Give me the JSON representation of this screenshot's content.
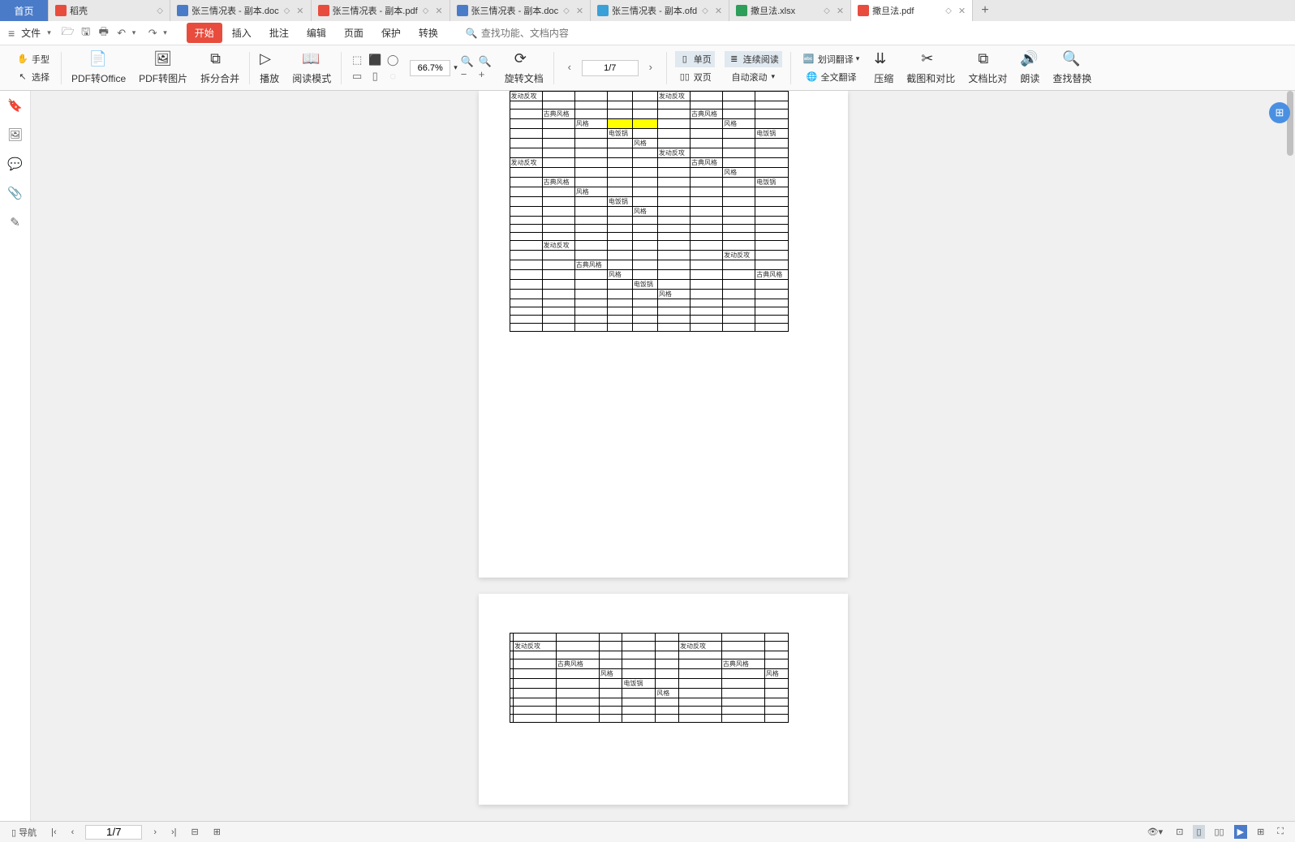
{
  "tabs": {
    "home": "首页",
    "items": [
      {
        "label": "稻壳",
        "icon": "#e84c3d"
      },
      {
        "label": "张三情况表 - 副本.doc",
        "icon": "#4a7bc8",
        "close": true
      },
      {
        "label": "张三情况表 - 副本.pdf",
        "icon": "#e84c3d",
        "close": true
      },
      {
        "label": "张三情况表 - 副本.doc",
        "icon": "#4a7bc8",
        "close": true
      },
      {
        "label": "张三情况表 - 副本.ofd",
        "icon": "#3aa0d8",
        "close": true
      },
      {
        "label": "撒旦法.xlsx",
        "icon": "#2e9e5b",
        "close": true
      },
      {
        "label": "撒旦法.pdf",
        "icon": "#e84c3d",
        "active": true,
        "close": true
      }
    ]
  },
  "menubar": {
    "file": "文件",
    "menus": [
      "开始",
      "插入",
      "批注",
      "编辑",
      "页面",
      "保护",
      "转换"
    ],
    "activeMenu": 0,
    "searchPlaceholder": "查找功能、文档内容"
  },
  "ribbon": {
    "hand": "手型",
    "select": "选择",
    "pdf2office": "PDF转Office",
    "pdf2img": "PDF转图片",
    "split": "拆分合并",
    "play": "播放",
    "readmode": "阅读模式",
    "zoom": "66.7%",
    "rotate": "旋转文档",
    "single": "单页",
    "double": "双页",
    "continuous": "连续阅读",
    "autoscroll": "自动滚动",
    "translate_word": "划词翻译",
    "translate_full": "全文翻译",
    "compress": "压缩",
    "screenshot": "截图和对比",
    "doccompare": "文档比对",
    "read": "朗读",
    "findreplace": "查找替换",
    "page_current": "1",
    "page_total": "7"
  },
  "status": {
    "nav": "导航",
    "page": "1/7"
  },
  "table_words": {
    "a": "发动反攻",
    "b": "古典风格",
    "c": "风格",
    "d": "电饭锅"
  },
  "page1_rows": [
    [
      {
        "t": "a",
        "c": 0
      },
      {
        "t": "a",
        "c": 5
      }
    ],
    [],
    [
      {
        "t": "b",
        "c": 1
      },
      {
        "t": "b",
        "c": 6
      }
    ],
    [
      {
        "t": "c",
        "c": 2
      },
      {
        "y": 1,
        "c": 3
      },
      {
        "y": 1,
        "c": 4
      },
      {
        "t": "c",
        "c": 7
      }
    ],
    [
      {
        "t": "d",
        "c": 3
      },
      {
        "t": "d",
        "c": 8
      }
    ],
    [
      {
        "t": "c",
        "c": 4
      }
    ],
    [
      {
        "t": "a",
        "c": 5
      }
    ],
    [
      {
        "t": "a",
        "c": 0
      },
      {
        "t": "b",
        "c": 6
      }
    ],
    [
      {
        "t": "c",
        "c": 7
      }
    ],
    [
      {
        "t": "b",
        "c": 1
      },
      {
        "t": "d",
        "c": 8
      }
    ],
    [
      {
        "t": "c",
        "c": 2
      }
    ],
    [
      {
        "t": "d",
        "c": 3
      }
    ],
    [
      {
        "t": "c",
        "c": 4
      }
    ],
    [],
    [],
    [],
    [
      {
        "t": "a",
        "c": 1
      }
    ],
    [
      {
        "t": "a",
        "c": 7
      }
    ],
    [
      {
        "t": "b",
        "c": 2
      }
    ],
    [
      {
        "t": "c",
        "c": 3
      },
      {
        "t": "b",
        "c": 8
      }
    ],
    [
      {
        "t": "d",
        "c": 4
      }
    ],
    [
      {
        "t": "c",
        "c": 5
      }
    ],
    [],
    [],
    [],
    []
  ],
  "page2_rows": [
    [],
    [
      {
        "t": "a",
        "c": 1
      },
      {
        "t": "a",
        "c": 6
      }
    ],
    [],
    [
      {
        "t": "b",
        "c": 2
      },
      {
        "t": "b",
        "c": 7
      }
    ],
    [
      {
        "t": "c",
        "c": 3
      },
      {
        "t": "c",
        "c": 8
      }
    ],
    [
      {
        "t": "d",
        "c": 4
      }
    ],
    [
      {
        "t": "c",
        "c": 5
      }
    ],
    [],
    [],
    []
  ]
}
